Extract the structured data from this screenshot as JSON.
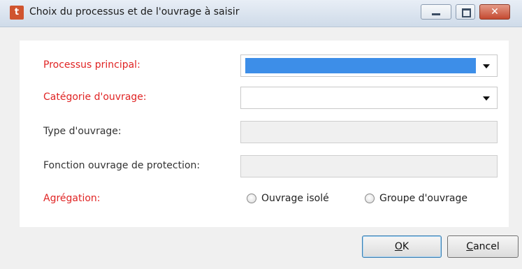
{
  "window": {
    "title": "Choix du processus et de l'ouvrage à saisir",
    "controls": {
      "close_glyph": "✕"
    }
  },
  "form": {
    "processus_principal": {
      "label": "Processus principal:",
      "value": ""
    },
    "categorie_ouvrage": {
      "label": "Catégorie d'ouvrage:",
      "value": ""
    },
    "type_ouvrage": {
      "label": "Type d'ouvrage:",
      "value": ""
    },
    "fonction_ouvrage": {
      "label": "Fonction ouvrage de protection:",
      "value": ""
    },
    "agregation": {
      "label": "Agrégation:",
      "options": [
        {
          "label": "Ouvrage isolé",
          "selected": false
        },
        {
          "label": "Groupe d'ouvrage",
          "selected": false
        }
      ]
    }
  },
  "buttons": {
    "ok_mnemonic": "O",
    "ok_rest": "K",
    "cancel_mnemonic": "C",
    "cancel_rest": "ancel"
  },
  "colors": {
    "required_label": "#e02424",
    "selection": "#3d8ee8"
  }
}
